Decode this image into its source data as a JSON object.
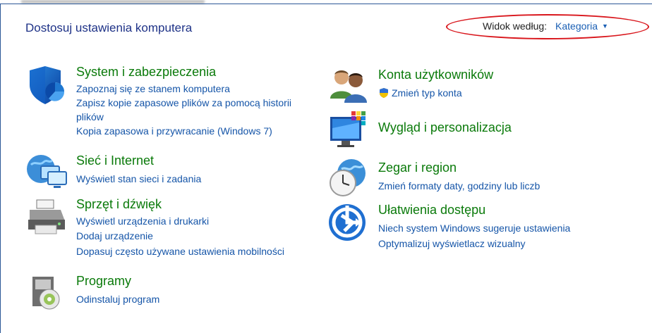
{
  "header": {
    "title": "Dostosuj ustawienia komputera",
    "view_by_label": "Widok według:",
    "view_by_value": "Kategoria"
  },
  "categories": {
    "system": {
      "title": "System i zabezpieczenia",
      "links": [
        "Zapoznaj się ze stanem komputera",
        "Zapisz kopie zapasowe plików za pomocą historii plików",
        "Kopia zapasowa i przywracanie (Windows 7)"
      ],
      "icon": "shield-icon"
    },
    "network": {
      "title": "Sieć i Internet",
      "links": [
        "Wyświetl stan sieci i zadania"
      ],
      "icon": "network-globe-icon"
    },
    "hardware": {
      "title": "Sprzęt i dźwięk",
      "links": [
        "Wyświetl urządzenia i drukarki",
        "Dodaj urządzenie",
        "Dopasuj często używane ustawienia mobilności"
      ],
      "icon": "printer-icon"
    },
    "programs": {
      "title": "Programy",
      "links": [
        "Odinstaluj program"
      ],
      "icon": "programs-disc-icon"
    },
    "accounts": {
      "title": "Konta użytkowników",
      "links": [
        "Zmień typ konta"
      ],
      "icon": "users-icon"
    },
    "appearance": {
      "title": "Wygląd i personalizacja",
      "links": [],
      "icon": "monitor-colors-icon"
    },
    "clock": {
      "title": "Zegar i region",
      "links": [
        "Zmień formaty daty, godziny lub liczb"
      ],
      "icon": "clock-globe-icon"
    },
    "access": {
      "title": "Ułatwienia dostępu",
      "links": [
        "Niech system Windows sugeruje ustawienia",
        "Optymalizuj wyświetlacz wizualny"
      ],
      "icon": "accessibility-icon"
    }
  },
  "colors": {
    "title_blue": "#1e3287",
    "category_green": "#0a7a0a",
    "link_blue": "#1555a8",
    "highlight_red": "#d9161c"
  }
}
